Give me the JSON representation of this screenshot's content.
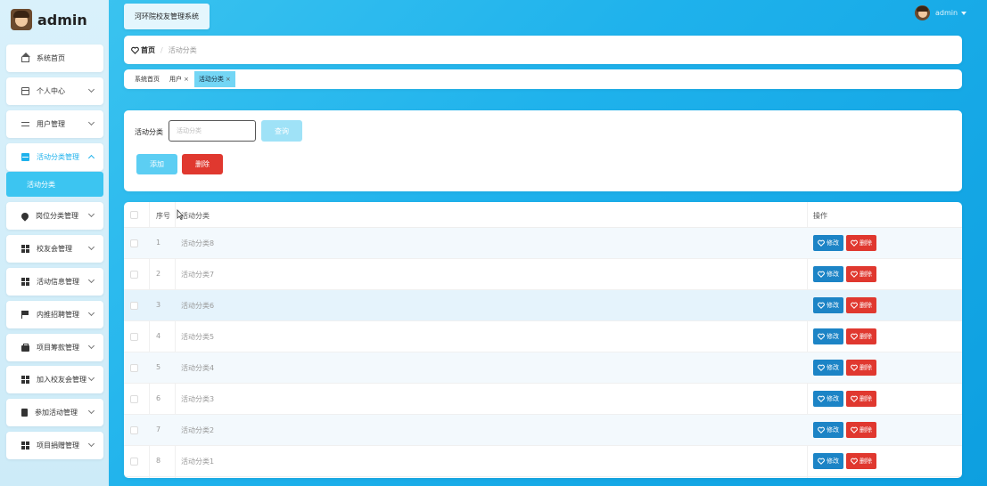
{
  "brand": {
    "name": "admin"
  },
  "sidebar": {
    "items": [
      {
        "label": "系统首页",
        "icon": "home-icon",
        "expandable": false
      },
      {
        "label": "个人中心",
        "icon": "id-card-icon",
        "expandable": true
      },
      {
        "label": "用户管理",
        "icon": "sliders-icon",
        "expandable": true
      },
      {
        "label": "活动分类管理",
        "icon": "book-icon",
        "expandable": true,
        "open": true
      },
      {
        "label": "岗位分类管理",
        "icon": "location-pin-icon",
        "expandable": true
      },
      {
        "label": "校友会管理",
        "icon": "grid-icon",
        "expandable": true
      },
      {
        "label": "活动信息管理",
        "icon": "grid-icon",
        "expandable": true
      },
      {
        "label": "内推招聘管理",
        "icon": "flag-icon",
        "expandable": true
      },
      {
        "label": "项目筹款管理",
        "icon": "briefcase-icon",
        "expandable": true
      },
      {
        "label": "加入校友会管理",
        "icon": "grid-icon",
        "expandable": true
      },
      {
        "label": "参加活动管理",
        "icon": "clipboard-icon",
        "expandable": true
      },
      {
        "label": "项目捐赠管理",
        "icon": "grid-icon",
        "expandable": true
      }
    ],
    "active_subitem": "活动分类"
  },
  "header": {
    "system_title": "河环院校友管理系统",
    "user": "admin"
  },
  "breadcrumb": {
    "home": "首页",
    "separator": "/",
    "current": "活动分类"
  },
  "tags": [
    {
      "label": "系统首页",
      "closable": false,
      "active": false
    },
    {
      "label": "用户",
      "closable": true,
      "active": false
    },
    {
      "label": "活动分类",
      "closable": true,
      "active": true
    }
  ],
  "search": {
    "label": "活动分类",
    "placeholder": "活动分类",
    "query_button": "查询",
    "add_button": "添加",
    "delete_button": "删除"
  },
  "table": {
    "columns": [
      "序号",
      "活动分类",
      "操作"
    ],
    "edit_label": "修改",
    "delete_label": "删除",
    "rows": [
      {
        "index": "1",
        "name": "活动分类8"
      },
      {
        "index": "2",
        "name": "活动分类7"
      },
      {
        "index": "3",
        "name": "活动分类6"
      },
      {
        "index": "4",
        "name": "活动分类5"
      },
      {
        "index": "5",
        "name": "活动分类4"
      },
      {
        "index": "6",
        "name": "活动分类3"
      },
      {
        "index": "7",
        "name": "活动分类2"
      },
      {
        "index": "8",
        "name": "活动分类1"
      }
    ]
  },
  "colors": {
    "accent": "#1fb2ec",
    "edit": "#1c84c6",
    "danger": "#e0382f"
  }
}
